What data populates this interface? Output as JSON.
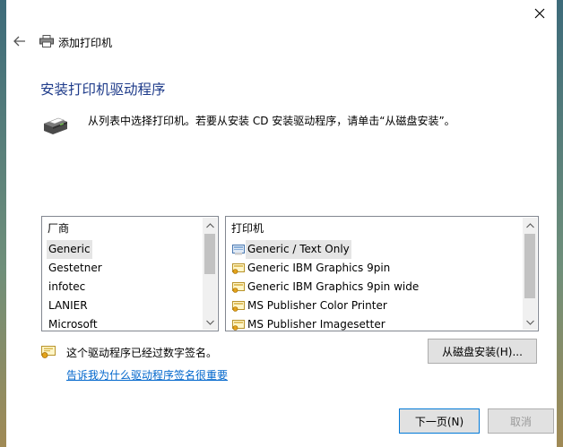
{
  "window": {
    "title": "添加打印机"
  },
  "page": {
    "heading": "安装打印机驱动程序",
    "instruction": "从列表中选择打印机。若要从安装 CD 安装驱动程序，请单击“从磁盘安装”。"
  },
  "manufacturers": {
    "header": "厂商",
    "items": [
      "Generic",
      "Gestetner",
      "infotec",
      "LANIER",
      "Microsoft"
    ],
    "selected": "Generic"
  },
  "printers": {
    "header": "打印机",
    "items": [
      "Generic / Text Only",
      "Generic IBM Graphics 9pin",
      "Generic IBM Graphics 9pin wide",
      "MS Publisher Color Printer",
      "MS Publisher Imagesetter"
    ],
    "selected": "Generic / Text Only"
  },
  "signature": {
    "text": "这个驱动程序已经过数字签名。",
    "link": "告诉我为什么驱动程序签名很重要"
  },
  "buttons": {
    "have_disk": "从磁盘安装(H)...",
    "next": "下一页(N)",
    "cancel": "取消"
  },
  "colors": {
    "heading": "#1e3b8a",
    "link": "#0066cc",
    "accent": "#0078d7"
  }
}
